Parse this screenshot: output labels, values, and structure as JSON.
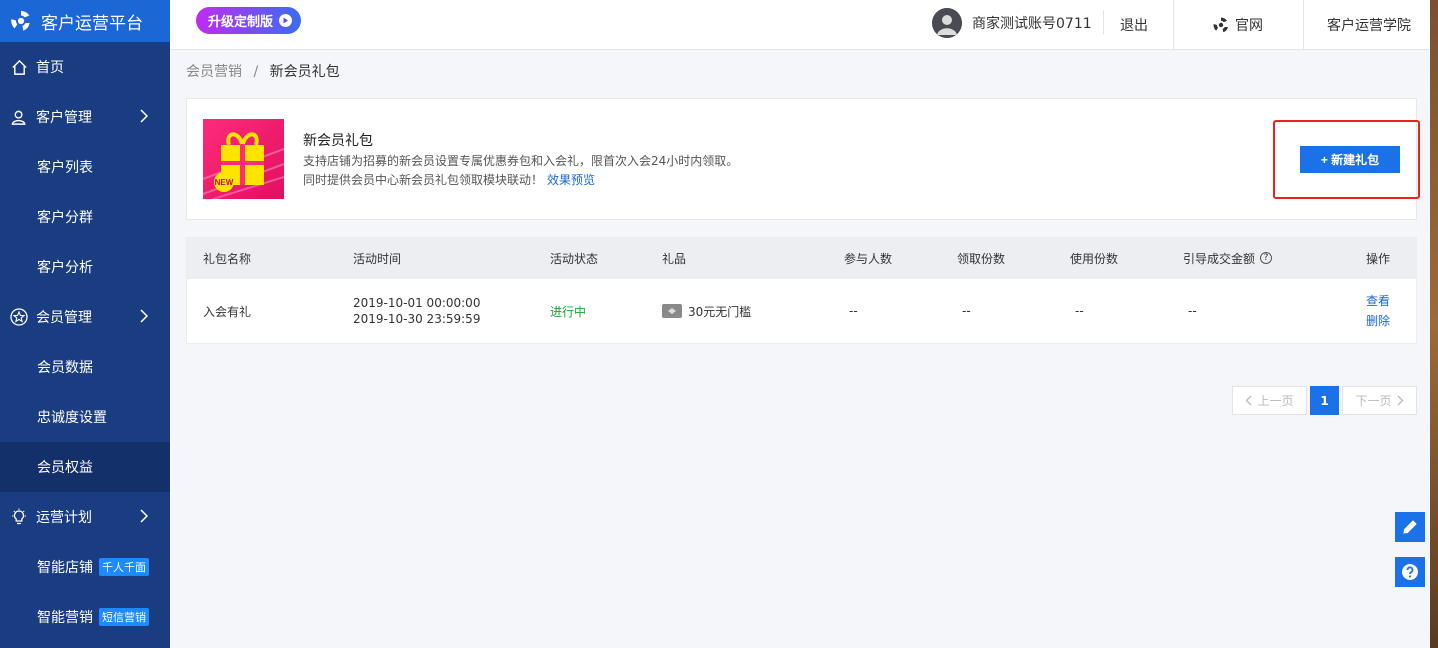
{
  "app": {
    "title": "客户运营平台"
  },
  "sidebar": {
    "items": [
      {
        "label": "首页",
        "icon": "home-icon"
      },
      {
        "label": "客户管理",
        "icon": "user-icon"
      },
      {
        "label": "客户列表"
      },
      {
        "label": "客户分群"
      },
      {
        "label": "客户分析"
      },
      {
        "label": "会员管理",
        "icon": "star-icon"
      },
      {
        "label": "会员数据"
      },
      {
        "label": "忠诚度设置"
      },
      {
        "label": "会员权益"
      },
      {
        "label": "运营计划",
        "icon": "bulb-icon"
      },
      {
        "label": "智能店铺",
        "badge": "千人千面"
      },
      {
        "label": "智能营销",
        "badge": "短信营销"
      }
    ]
  },
  "topbar": {
    "upgrade_label": "升级定制版",
    "account_name": "商家测试账号0711",
    "logout": "退出",
    "official_site": "官网",
    "academy": "客户运营学院"
  },
  "breadcrumb": {
    "parent": "会员营销",
    "separator": "/",
    "current": "新会员礼包"
  },
  "intro": {
    "title": "新会员礼包",
    "desc_line1": "支持店铺为招募的新会员设置专属优惠券包和入会礼，限首次入会24小时内领取。",
    "desc_line2": "同时提供会员中心新会员礼包领取模块联动！",
    "preview_link": "效果预览",
    "new_button": "+ 新建礼包"
  },
  "table": {
    "headers": [
      "礼包名称",
      "活动时间",
      "活动状态",
      "礼品",
      "参与人数",
      "领取份数",
      "使用份数",
      "引导成交金额",
      "操作"
    ],
    "help_glyph": "?",
    "rows": [
      {
        "name": "入会有礼",
        "time_start": "2019-10-01 00:00:00",
        "time_end": "2019-10-30 23:59:59",
        "status": "进行中",
        "gift": "30元无门槛",
        "participants": "--",
        "received": "--",
        "used": "--",
        "gmv": "--",
        "op_view": "查看",
        "op_delete": "删除"
      }
    ]
  },
  "pagination": {
    "prev": "上一页",
    "current": "1",
    "next": "下一页"
  },
  "colors": {
    "sidebar_bg": "#1a3d82",
    "logo_bg": "#1b67d6",
    "primary": "#1b72e8",
    "highlight": "#e5251e",
    "status_ok": "#1aa82a"
  }
}
